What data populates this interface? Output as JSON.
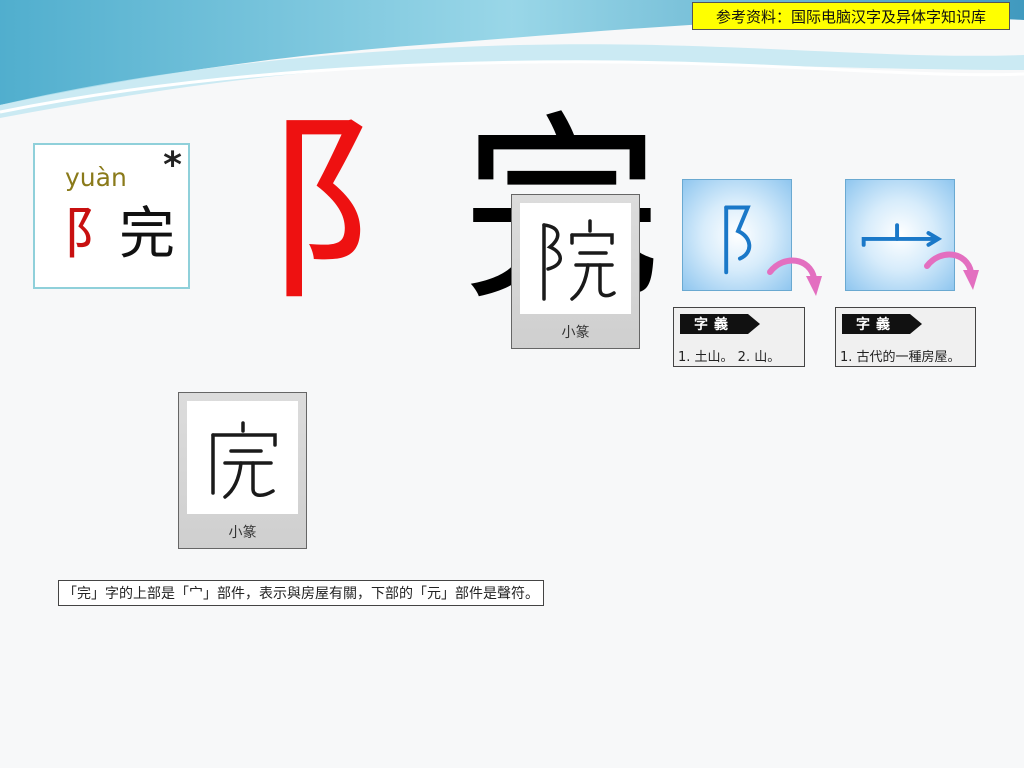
{
  "source_badge": "参考资料：国际电脑汉字及异体字知识库",
  "pinyin_card": {
    "pinyin": "yuàn",
    "star": "*",
    "char_left": "阝",
    "char_right": "完"
  },
  "main_char": {
    "left": "阝",
    "right": "完"
  },
  "seal_cards": [
    {
      "label": "小篆"
    },
    {
      "label": "小篆"
    }
  ],
  "radicals": [
    {
      "glyph": "阝",
      "meaning_tag": "字義",
      "meaning_text": "1. 土山。   2. 山。"
    },
    {
      "glyph": "宀",
      "meaning_tag": "字義",
      "meaning_text": "1. 古代的一種房屋。"
    }
  ],
  "note": "「完」字的上部是「宀」部件，表示與房屋有關，下部的「元」部件是聲符。",
  "colors": {
    "radical_red": "#ee1111",
    "radical_blue": "#1a78c8",
    "arrow_pink": "#e36fc0",
    "badge_yellow": "#ffff00"
  }
}
